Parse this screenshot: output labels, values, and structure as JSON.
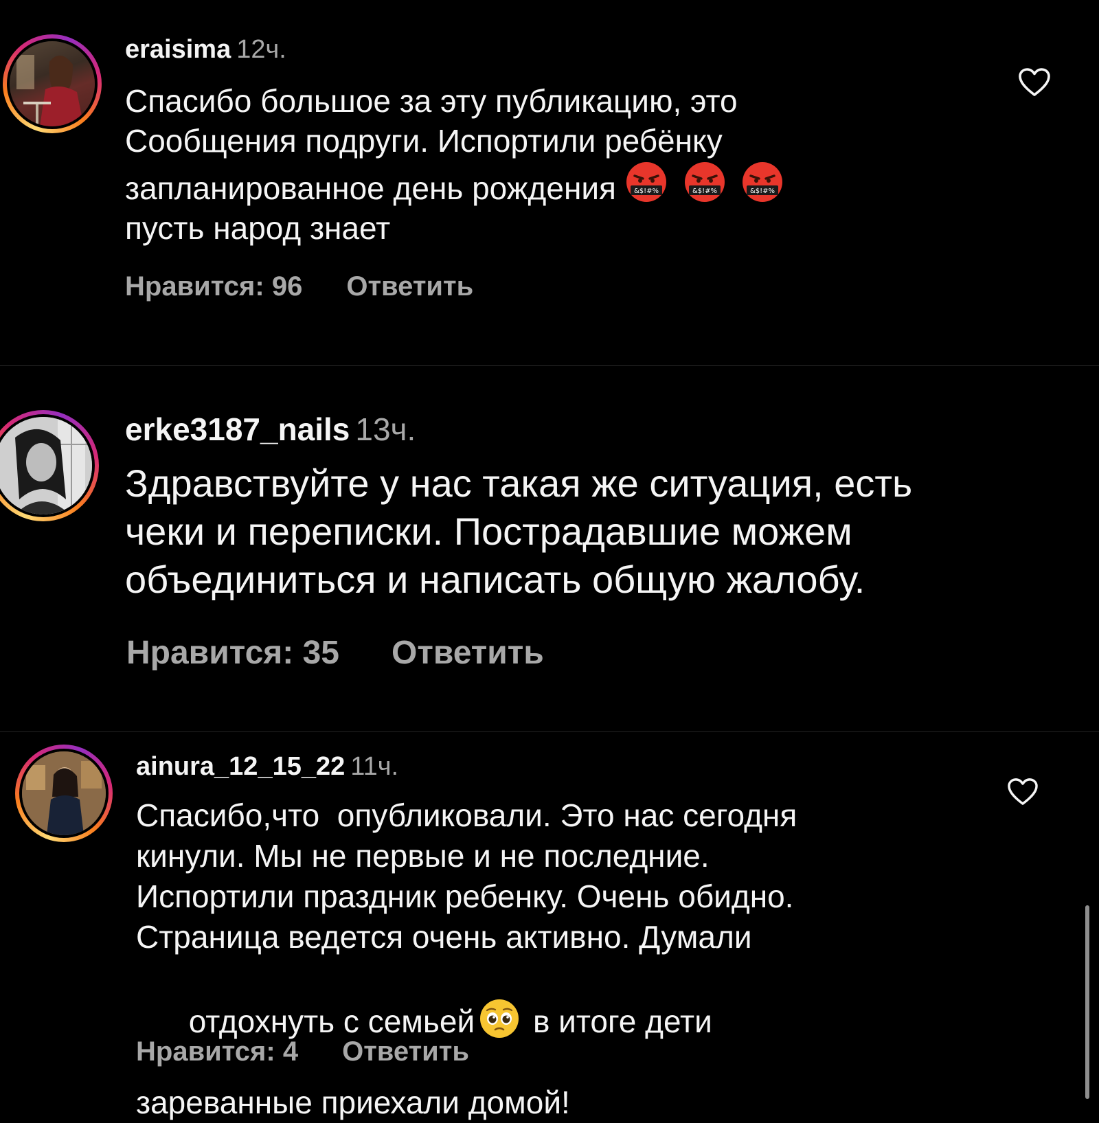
{
  "comments": [
    {
      "username": "eraisima",
      "time": "12ч.",
      "text_line1": "Спасибо большое за эту публикацию, это",
      "text_line2": "Сообщения подруги. Испортили ребёнку",
      "text_line3": "запланированное день рождения",
      "text_line4": "пусть народ знает",
      "emoji_tail": [
        "cursing-face",
        "cursing-face",
        "cursing-face"
      ],
      "likes_label": "Нравится: 96",
      "reply_label": "Ответить"
    },
    {
      "username": "erke3187_nails",
      "time": "13ч.",
      "text_line1": "Здравствуйте у нас такая же ситуация, есть",
      "text_line2": "чеки и переписки. Пострадавшие можем",
      "text_line3": "объединиться и написать общую жалобу.",
      "likes_label": "Нравится: 35",
      "reply_label": "Ответить"
    },
    {
      "username": "ainura_12_15_22",
      "time": "11ч.",
      "text_line1": "Спасибо,что  опубликовали. Это нас сегодня",
      "text_line2": "кинули. Мы не первые и не последние.",
      "text_line3": "Испортили праздник ребенку. Очень обидно.",
      "text_line4": "Страница ведется очень активно. Думали",
      "text_line5a": "отдохнуть с семьей",
      "text_line5b": " в итоге дети",
      "text_line6": "зареванные приехали домой!",
      "emoji_inline": "pleading-face",
      "likes_label": "Нравится: 4",
      "reply_label": "Ответить"
    }
  ],
  "icons": {
    "like": "heart-outline-icon",
    "emoji_angry": "cursing-face",
    "emoji_pleading": "pleading-face"
  },
  "colors": {
    "background": "#000000",
    "text": "#f5f5f5",
    "secondary": "#a8a8a8",
    "divider": "#262626",
    "story_ring_start": "#feda75",
    "story_ring_end": "#962fbf"
  }
}
